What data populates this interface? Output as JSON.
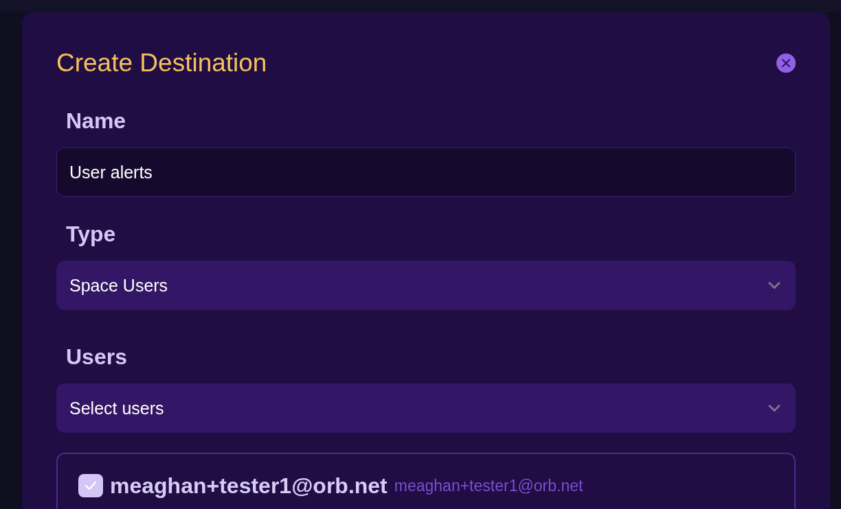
{
  "dialog": {
    "title": "Create Destination"
  },
  "fields": [
    {
      "kind": "text",
      "label": "Name",
      "value": "User alerts"
    },
    {
      "kind": "select",
      "label": "Type",
      "value": "Space Users"
    },
    {
      "kind": "select",
      "label": "Users",
      "placeholder": "Select users"
    }
  ],
  "users": [
    {
      "name": "meaghan+tester1@orb.net",
      "email": "meaghan+tester1@orb.net",
      "checked": true
    }
  ]
}
